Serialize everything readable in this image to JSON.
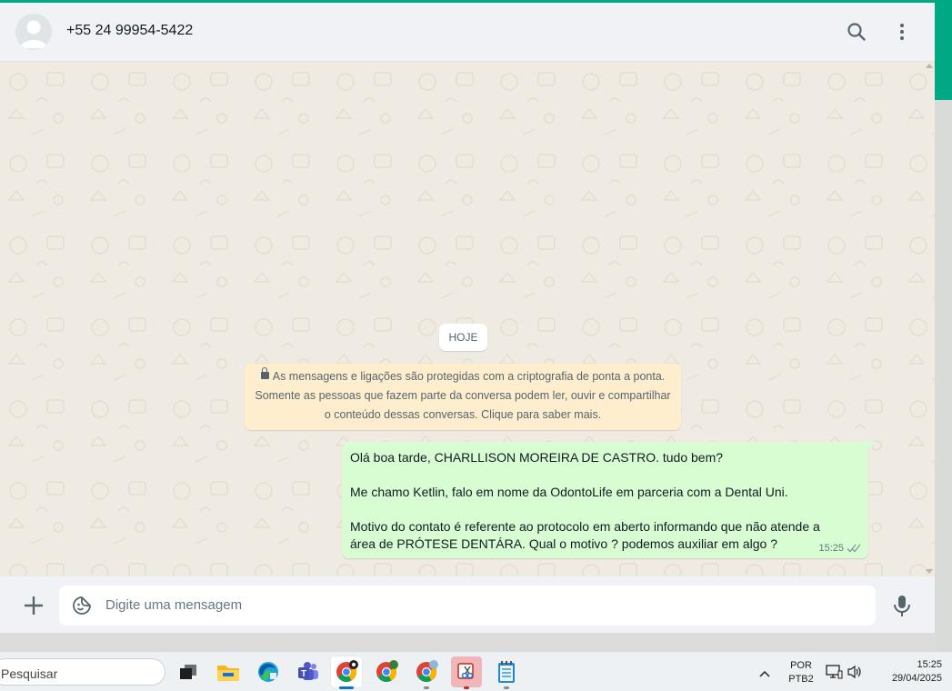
{
  "header": {
    "contact": "+55 24 99954-5422",
    "search_icon": "search-icon",
    "menu_icon": "more-vertical-icon"
  },
  "chat": {
    "date_divider": "HOJE",
    "encryption_notice": [
      "As mensagens e ligações são protegidas com a criptografia de ponta a ponta.",
      "Somente as pessoas que fazem parte da conversa podem ler, ouvir e compartilhar",
      "o conteúdo dessas conversas. Clique para saber mais."
    ],
    "messages": [
      {
        "direction": "outgoing",
        "lines": [
          "Olá boa tarde,  CHARLLISON MOREIRA DE CASTRO. tudo bem?",
          "",
          "Me chamo Ketlin, falo em nome da OdontoLife em parceria com a Dental Uni.",
          "",
          "Motivo do contato é referente ao protocolo em aberto informando que não atende a",
          "área de PRÓTESE DENTÁRA. Qual o motivo ? podemos auxiliar em algo ?"
        ],
        "time": "15:25",
        "status_icon": "double-check-icon"
      }
    ]
  },
  "composer": {
    "placeholder": "Digite uma mensagem",
    "attach_icon": "plus-icon",
    "sticker_icon": "sticker-icon",
    "mic_icon": "microphone-icon"
  },
  "taskbar": {
    "search_placeholder": "Pesquisar",
    "language_top": "POR",
    "language_bottom": "PTB2",
    "time": "15:25",
    "date": "29/04/2025"
  },
  "colors": {
    "accent": "#00a884",
    "outgoing_bubble": "#d9fdd3",
    "notice_bg": "#ffeecd",
    "chat_bg": "#efeae2"
  }
}
